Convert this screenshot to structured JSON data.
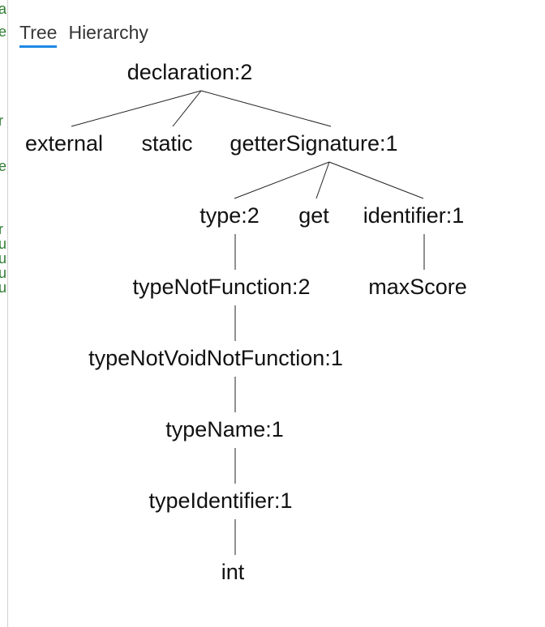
{
  "tabs": [
    {
      "label": "Tree",
      "active": true
    },
    {
      "label": "Hierarchy",
      "active": false
    }
  ],
  "gutter": {
    "letters": [
      "a",
      "e",
      "r",
      "e",
      "r",
      "u",
      "u",
      "u",
      "u"
    ]
  },
  "accent_color": "#1e88e5",
  "gutter_color": "#2e7d32",
  "tree": {
    "label": "declaration:2",
    "children": [
      {
        "label": "external",
        "children": []
      },
      {
        "label": "static",
        "children": []
      },
      {
        "label": "getterSignature:1",
        "children": [
          {
            "label": "type:2",
            "children": [
              {
                "label": "typeNotFunction:2",
                "children": [
                  {
                    "label": "typeNotVoidNotFunction:1",
                    "children": [
                      {
                        "label": "typeName:1",
                        "children": [
                          {
                            "label": "typeIdentifier:1",
                            "children": [
                              {
                                "label": "int",
                                "children": []
                              }
                            ]
                          }
                        ]
                      }
                    ]
                  }
                ]
              }
            ]
          },
          {
            "label": "get",
            "children": []
          },
          {
            "label": "identifier:1",
            "children": [
              {
                "label": "maxScore",
                "children": []
              }
            ]
          }
        ]
      }
    ]
  }
}
